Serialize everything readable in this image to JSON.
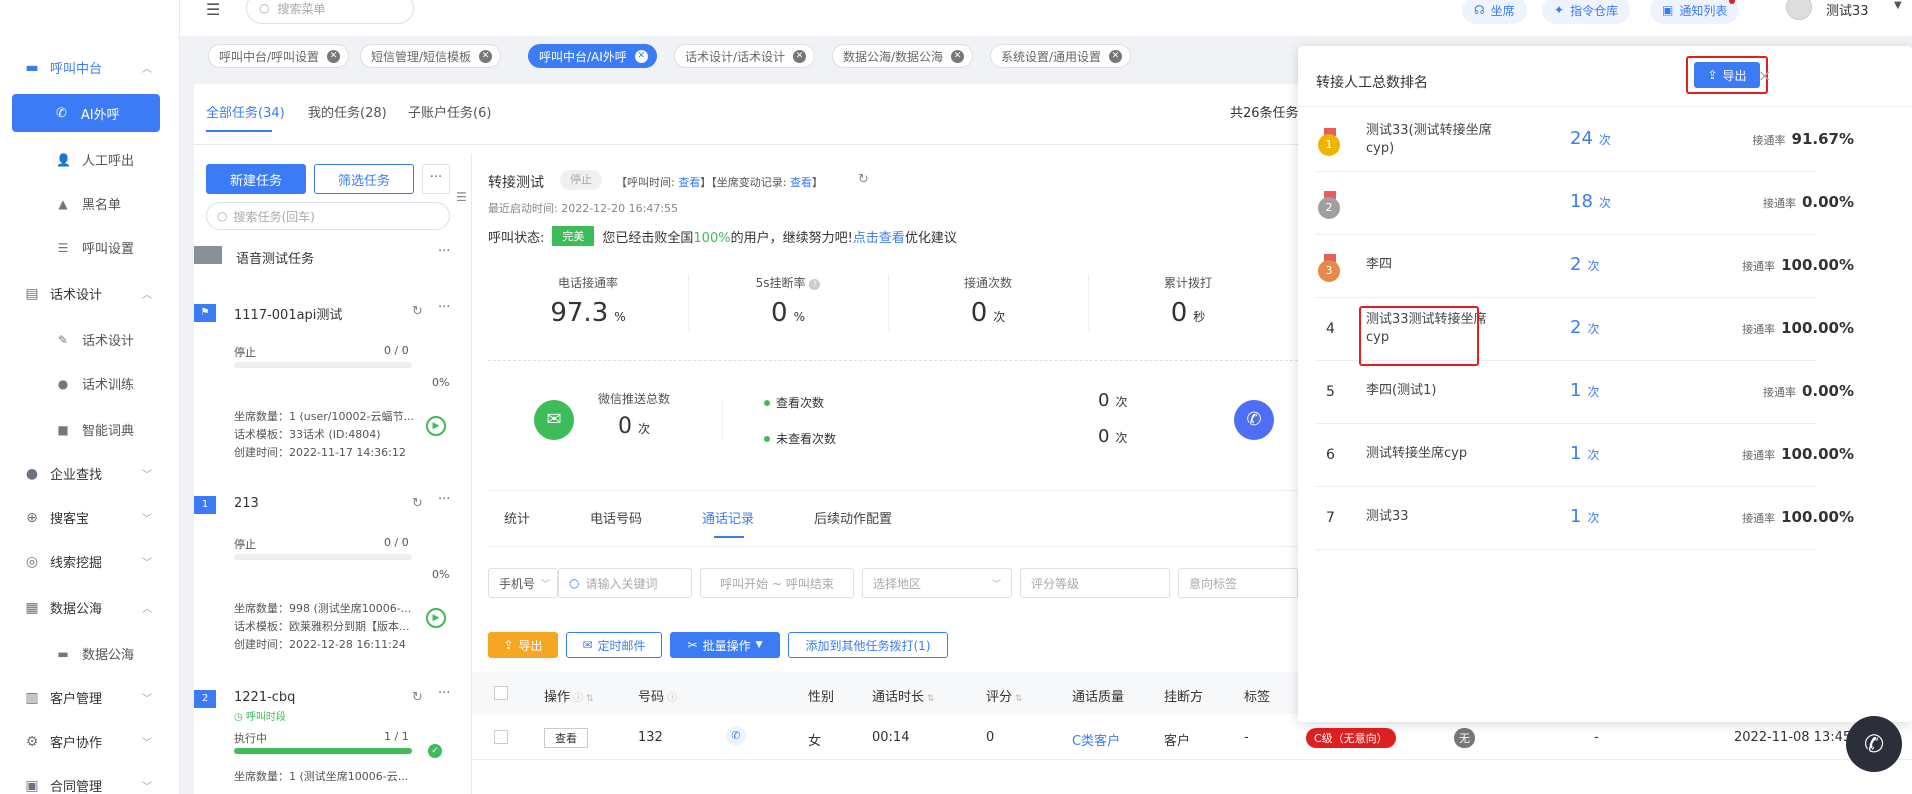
{
  "top": {
    "search_placeholder": "搜索菜单",
    "seat_btn": "坐席",
    "instruction_btn": "指令仓库",
    "notify_btn": "通知列表",
    "user": "测试33"
  },
  "nav": {
    "call_center": "呼叫中台",
    "ai_call": "AI外呼",
    "manual_call": "人工呼出",
    "blacklist": "黑名单",
    "call_settings": "呼叫设置",
    "script_design": "话术设计",
    "script_design_item": "话术设计",
    "script_training": "话术训练",
    "smart_dict": "智能词典",
    "enterprise_search": "企业查找",
    "sokebao": "搜客宝",
    "lead_mining": "线索挖掘",
    "data_sea": "数据公海",
    "data_sea_item": "数据公海",
    "customer_mgmt": "客户管理",
    "customer_collab": "客户协作",
    "contract_mgmt": "合同管理"
  },
  "tabs": [
    "呼叫中台/呼叫设置",
    "短信管理/短信模板",
    "呼叫中台/AI外呼",
    "话术设计/话术设计",
    "数据公海/数据公海",
    "系统设置/通用设置"
  ],
  "subtabs": {
    "all": "全部任务(34)",
    "mine": "我的任务(28)",
    "sub": "子账户任务(6)",
    "total": "共26条任务"
  },
  "left": {
    "new_task": "新建任务",
    "filter_task": "筛选任务",
    "more": "···",
    "search_placeholder": "搜索任务(回车)",
    "group_name": "语音测试任务",
    "tasks": [
      {
        "badge": "⚑",
        "name": "1117-001api测试",
        "status": "停止",
        "ratio": "0 / 0",
        "percent": "0%",
        "progress": 0,
        "seats": "坐席数量：1 (user/10002-云蝠节...",
        "template": "话术模板：33话术 (ID:4804)",
        "created": "创建时间：2022-11-17 14:36:12"
      },
      {
        "badge": "1",
        "name": "213",
        "status": "停止",
        "ratio": "0 / 0",
        "percent": "0%",
        "progress": 0,
        "seats": "坐席数量：998 (测试坐席10006-...",
        "template": "话术模板：欧莱雅积分到期【版本...",
        "created": "创建时间：2022-12-28 16:11:24"
      },
      {
        "badge": "2",
        "name": "1221-cbq",
        "status": "执行中",
        "ratio": "1 / 1",
        "percent": "",
        "progress": 1,
        "call_time": "呼叫时段",
        "seats": "坐席数量：1 (测试坐席10006-云..."
      }
    ]
  },
  "detail": {
    "title": "转接测试",
    "stop_tag": "停止",
    "call_time_label": "【呼叫时间:",
    "view1": "查看",
    "seat_change_label": "】【坐席变动记录:",
    "view2": "查看",
    "bracket_end": "】",
    "last_start": "最近启动时间: 2022-12-20 16:47:55",
    "call_status_label": "呼叫状态:",
    "perfect": "完美",
    "status_text_1": "您已经击败全国",
    "status_pct": "100%",
    "status_text_2": "的用户，继续努力吧!",
    "status_link": "点击查看",
    "status_text_3": "优化建议",
    "stats": [
      {
        "label": "电话接通率",
        "value": "97.3",
        "unit": "%"
      },
      {
        "label": "5s挂断率",
        "value": "0",
        "unit": "%"
      },
      {
        "label": "接通次数",
        "value": "0",
        "unit": "次"
      },
      {
        "label": "累计拨打",
        "value": "0",
        "unit": "秒"
      }
    ],
    "wechat_label": "微信推送总数",
    "wechat_value": "0",
    "wechat_unit": "次",
    "view_count_label": "查看次数",
    "view_count": "0",
    "unview_count_label": "未查看次数",
    "unview_count": "0",
    "count_unit": "次",
    "tabs": [
      "统计",
      "电话号码",
      "通话记录",
      "后续动作配置"
    ],
    "filters": {
      "phone": "手机号",
      "keyword": "请输入关键词",
      "date": "呼叫开始 ~ 呼叫结束",
      "region": "选择地区",
      "grade": "评分等级",
      "intent": "意向标签"
    },
    "actions": {
      "export": "导出",
      "timed": "定时邮件",
      "batch": "批量操作",
      "add_other": "添加到其他任务拨打(1)"
    },
    "table_headers": [
      "操作",
      "号码",
      "性别",
      "通话时长",
      "评分",
      "通话质量",
      "挂断方",
      "标签"
    ],
    "row": {
      "view": "查看",
      "number": "132",
      "gender": "女",
      "duration": "00:14",
      "score": "0",
      "quality": "C类客户",
      "hangup": "客户",
      "tag": "-",
      "grade": "C级（无意向）",
      "none": "无",
      "dash": "-",
      "date": "2022-11-08 13:45"
    }
  },
  "ranking": {
    "title": "转接人工总数排名",
    "export": "导出",
    "close": "×",
    "rate_label": "接通率",
    "count_unit": "次",
    "rows": [
      {
        "rank": "1",
        "name": "测试33(测试转接坐席cyp)",
        "count": "24",
        "rate": "91.67%",
        "medal": "gold"
      },
      {
        "rank": "2",
        "name": "",
        "count": "18",
        "rate": "0.00%",
        "medal": "silver"
      },
      {
        "rank": "3",
        "name": "李四",
        "count": "2",
        "rate": "100.00%",
        "medal": "bronze"
      },
      {
        "rank": "4",
        "name": "测试33测试转接坐席cyp",
        "count": "2",
        "rate": "100.00%",
        "medal": ""
      },
      {
        "rank": "5",
        "name": "李四(测试1)",
        "count": "1",
        "rate": "0.00%",
        "medal": ""
      },
      {
        "rank": "6",
        "name": "测试转接坐席cyp",
        "count": "1",
        "rate": "100.00%",
        "medal": ""
      },
      {
        "rank": "7",
        "name": "测试33",
        "count": "1",
        "rate": "100.00%",
        "medal": ""
      }
    ]
  },
  "colors": {
    "primary": "#3b7cf6",
    "success": "#3dbd5a",
    "danger": "#e02020",
    "orange": "#f5a623",
    "gold": "#f0b400",
    "silver": "#a0a0a0",
    "bronze": "#e8894a"
  }
}
